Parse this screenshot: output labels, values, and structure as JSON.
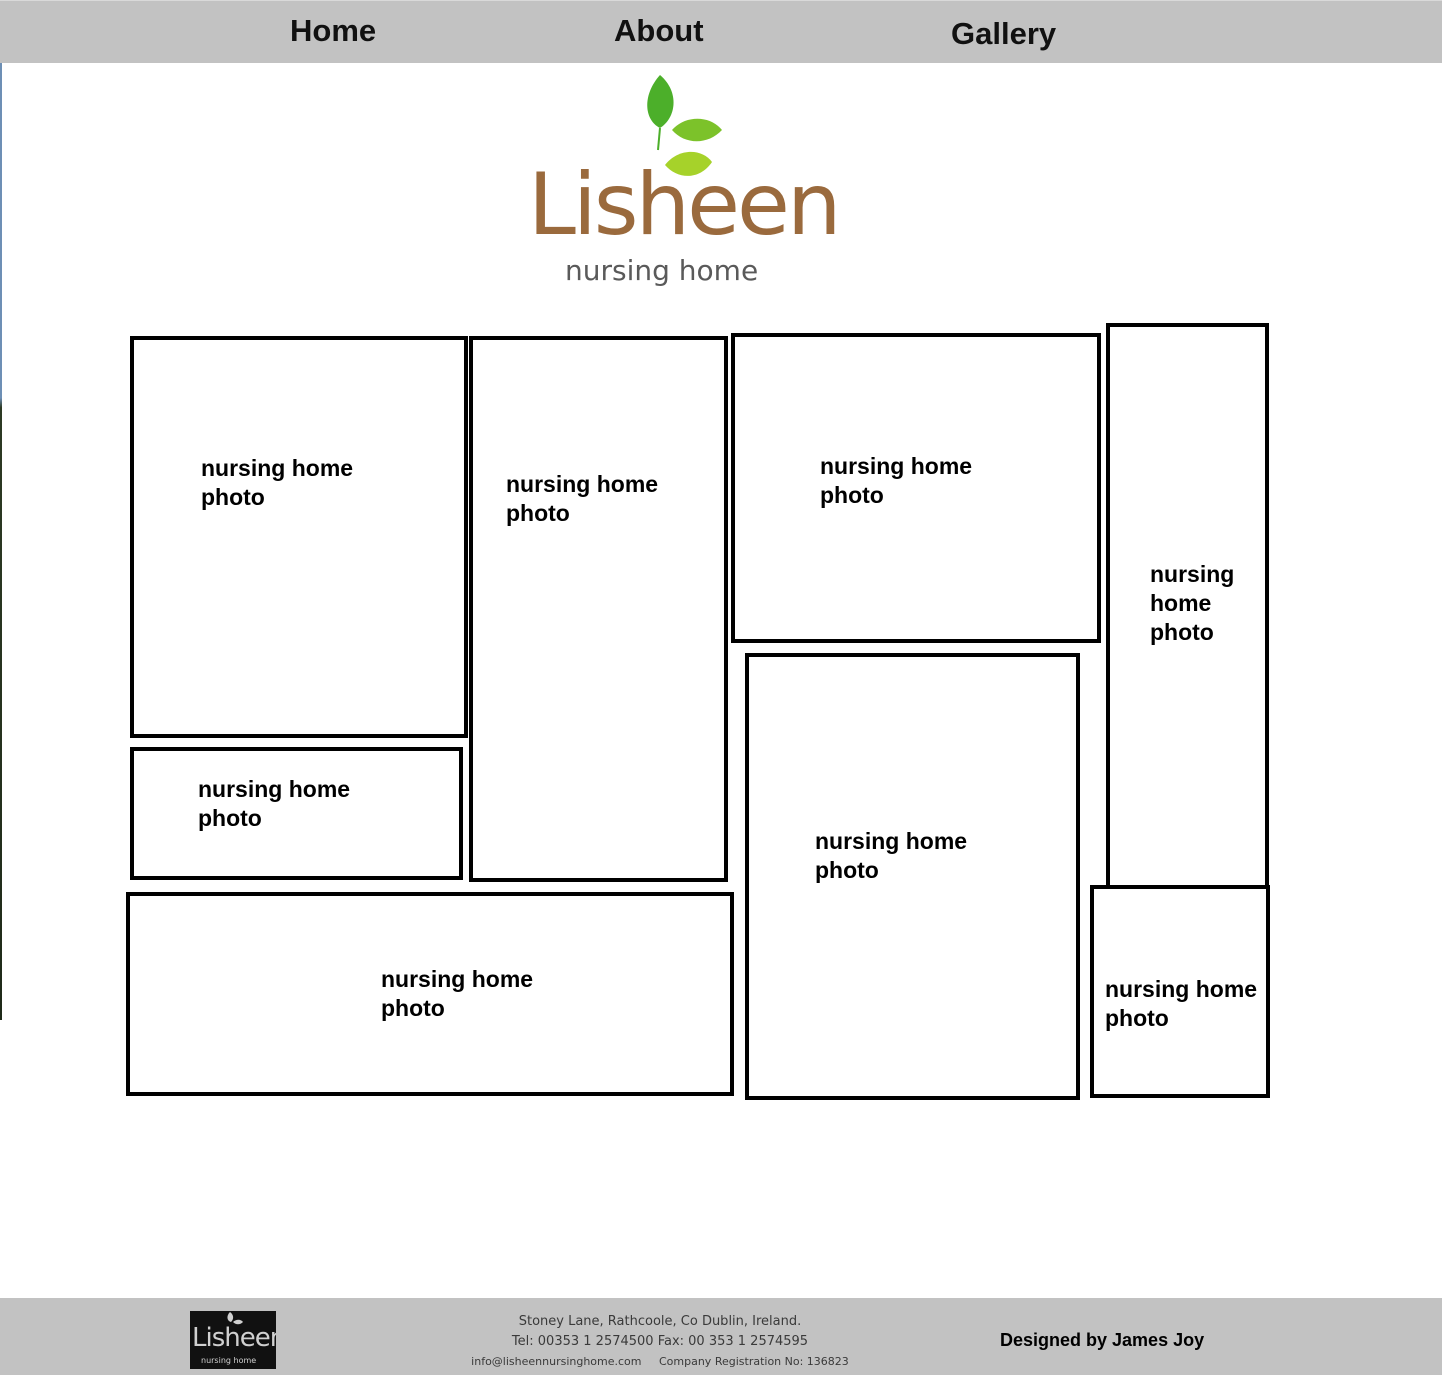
{
  "nav": {
    "home": "Home",
    "about": "About",
    "gallery": "Gallery"
  },
  "logo": {
    "word": "Lisheen",
    "sub": "nursing home",
    "leaf_color_dark": "#4caf2a",
    "leaf_color_light": "#a6d22a",
    "word_color": "#9a6a3d"
  },
  "gallery": {
    "photos": [
      {
        "label": "nursing home\nphoto"
      },
      {
        "label": "nursing home\nphoto"
      },
      {
        "label": "nursing home\nphoto"
      },
      {
        "label": "nursing\nhome\nphoto"
      },
      {
        "label": "nursing home\nphoto"
      },
      {
        "label": "nursing home\nphoto"
      },
      {
        "label": "nursing home\nphoto"
      },
      {
        "label": "nursing home\nphoto"
      }
    ]
  },
  "footer": {
    "logo_word": "Lisheen",
    "logo_sub": "nursing home",
    "address_line1": "Stoney Lane, Rathcoole, Co Dublin, Ireland.",
    "address_line2": "Tel: 00353 1 2574500 Fax: 00 353 1 2574595",
    "address_line3": "info@lisheennursinghome.com     Company Registration No: 136823",
    "designed_by": "Designed by James Joy"
  },
  "colors": {
    "bar_background": "#c2c2c2",
    "border": "#000000"
  }
}
